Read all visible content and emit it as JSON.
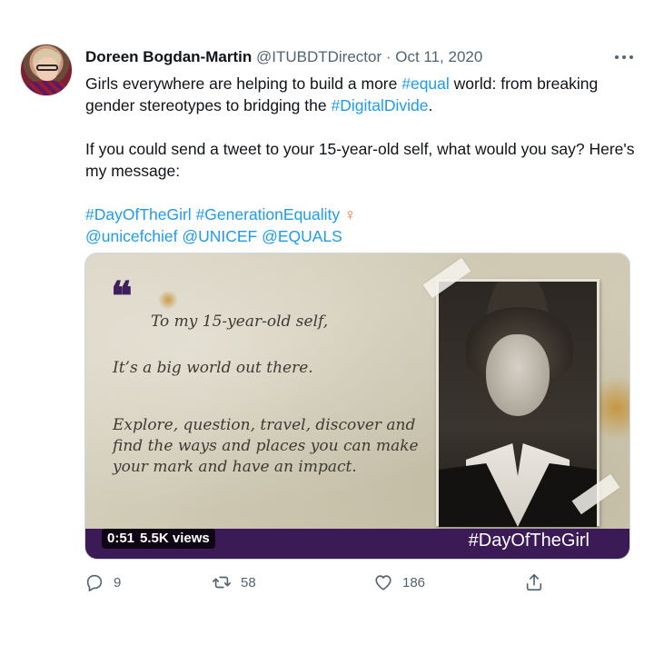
{
  "tweet": {
    "author_name": "Doreen Bogdan-Martin",
    "author_handle": "@ITUBDTDirector",
    "date_separator": " · ",
    "date": "Oct 11, 2020",
    "more_icon": "more-icon",
    "line1_a": "Girls everywhere are helping to build a more ",
    "hashtag_equal": "#equal",
    "line1_b": " world: from breaking gender stereotypes to bridging the ",
    "hashtag_digitaldivide": "#DigitalDivide",
    "line1_c": ".",
    "line2": "If you could send a tweet to your 15-year-old self, what would you say? Here's my message:",
    "hashtag_dayofthegirl": "#DayOfTheGirl",
    "hashtag_generationequality": "#GenerationEquality",
    "venus_symbol": "♀",
    "mention_unicefchief": "@unicefchief",
    "mention_unicef": "@UNICEF",
    "mention_equals": "@EQUALS"
  },
  "media": {
    "quote_mark": "❝",
    "letter_greeting": "To my 15-year-old self,",
    "letter_line": "It’s a big world out there.",
    "letter_body": "Explore, question, travel, discover and find the ways and places you can make your mark and have an impact.",
    "time": "0:51",
    "views": "5.5K views",
    "overlay_hashtag": "#DayOfTheGirl",
    "progress_fraction": 0.0,
    "bar_color": "#3b1a55"
  },
  "actions": {
    "reply_count": "9",
    "retweet_count": "58",
    "like_count": "186",
    "reply_icon": "reply-icon",
    "retweet_icon": "retweet-icon",
    "like_icon": "heart-icon",
    "share_icon": "share-icon"
  },
  "colors": {
    "link": "#1d9bf0",
    "venus": "#f06a2a",
    "muted": "#536471"
  }
}
